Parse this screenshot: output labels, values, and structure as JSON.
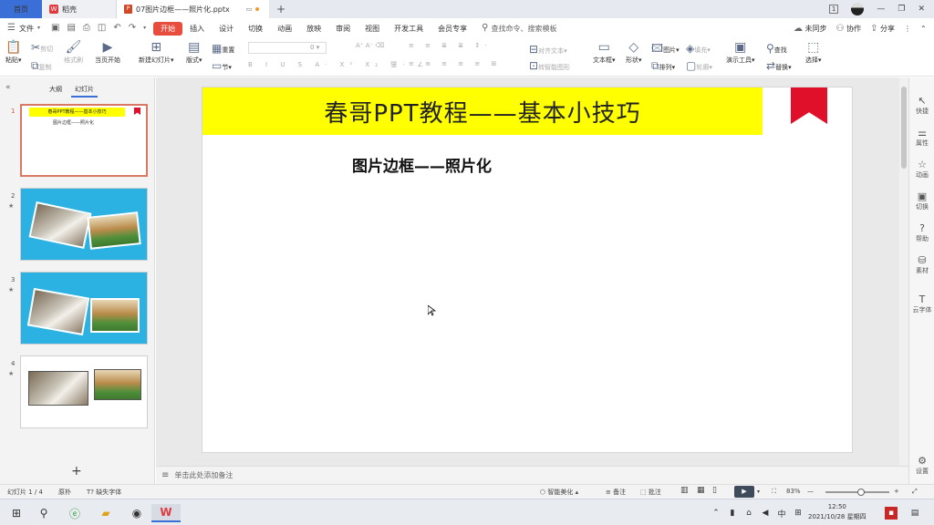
{
  "titlebar": {
    "home_tab": "首页",
    "daoke_tab": "稻壳",
    "doc_tab": "07图片边框——照片化.pptx",
    "new_tab": "+",
    "controls": [
      "1",
      "—",
      "❐",
      "✕"
    ]
  },
  "menubar": {
    "file": "文件",
    "items": [
      "开始",
      "插入",
      "设计",
      "切换",
      "动画",
      "放映",
      "审阅",
      "视图",
      "开发工具",
      "会员专享"
    ],
    "search_placeholder": "查找命令、搜索模板",
    "sync": "未同步",
    "collab": "协作",
    "share": "分享"
  },
  "ribbon": {
    "paste": "粘贴",
    "cut": "剪切",
    "copy": "复制",
    "format_painter": "格式刷",
    "play_from_current": "当页开始",
    "new_slide": "新建幻灯片",
    "layout": "版式",
    "section": "节",
    "reset": "重置",
    "font_size": "0",
    "align_text": "对齐文本",
    "convert_smartart": "转智能图形",
    "textbox": "文本框",
    "shapes": "形状",
    "picture": "图片",
    "fill": "填充",
    "arrange": "排列",
    "outline": "轮廓",
    "presenter_tools": "演示工具",
    "find": "查找",
    "replace": "替换",
    "select": "选择"
  },
  "left_panel": {
    "collapse_glyph": "«",
    "tab_outline": "大纲",
    "tab_slides": "幻灯片",
    "slides": [
      {
        "num": "1",
        "star": "",
        "title": "春哥PPT教程——基本小技巧",
        "subtitle": "图片边框——照片化"
      },
      {
        "num": "2",
        "star": "★"
      },
      {
        "num": "3",
        "star": "★"
      },
      {
        "num": "4",
        "star": "★"
      }
    ],
    "add_glyph": "+"
  },
  "slide": {
    "title": "春哥PPT教程——基本小技巧",
    "subtitle": "图片边框——照片化",
    "title_bg": "#ffff00",
    "flag_color": "#e0102b"
  },
  "notes": {
    "placeholder": "单击此处添加备注"
  },
  "right_panel": {
    "items": [
      "快捷",
      "属性",
      "动画",
      "切换",
      "帮助",
      "素材",
      "云字体",
      "设置"
    ]
  },
  "statusbar": {
    "slide_count": "幻灯片 1 / 4",
    "theme": "原朴",
    "missing_font": "缺失字体",
    "beautify": "智能美化",
    "notes": "备注",
    "comments": "批注",
    "zoom": "83%"
  },
  "taskbar": {
    "time": "12:50",
    "date": "2021/10/28 星期四",
    "ime": "中"
  }
}
